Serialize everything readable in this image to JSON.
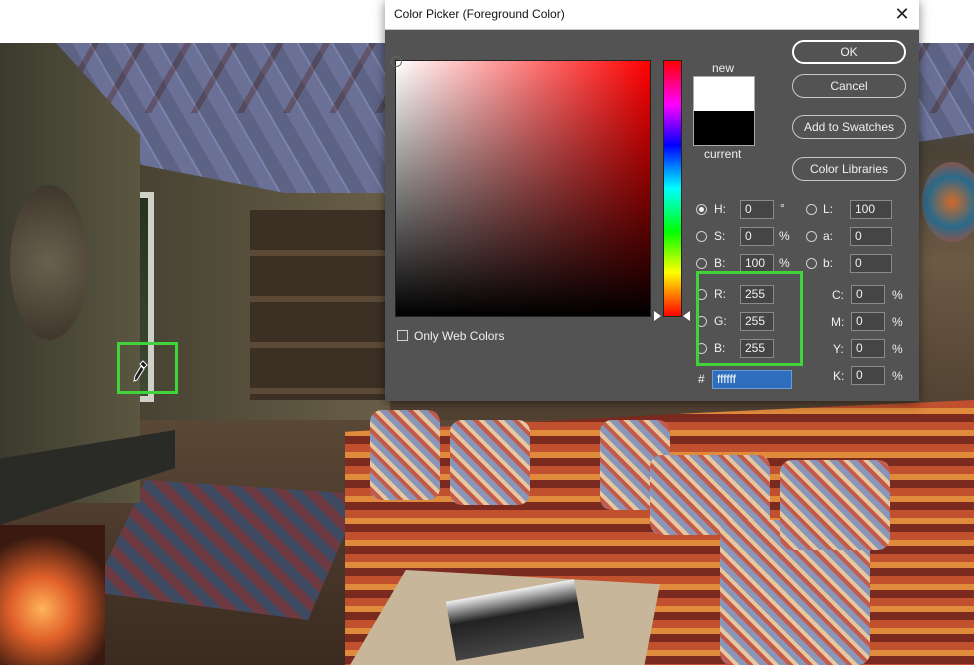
{
  "dialog": {
    "title": "Color Picker (Foreground Color)",
    "close_glyph": "✕",
    "swatch_new_label": "new",
    "swatch_current_label": "current",
    "new_color": "#ffffff",
    "current_color": "#000000",
    "buttons": {
      "ok": "OK",
      "cancel": "Cancel",
      "add_to_swatches": "Add to Swatches",
      "color_libraries": "Color Libraries"
    },
    "only_web_colors": "Only Web Colors",
    "hsb": {
      "h": {
        "label": "H:",
        "value": "0",
        "unit": "°",
        "selected": true
      },
      "s": {
        "label": "S:",
        "value": "0",
        "unit": "%"
      },
      "b": {
        "label": "B:",
        "value": "100",
        "unit": "%"
      }
    },
    "rgb": {
      "r": {
        "label": "R:",
        "value": "255"
      },
      "g": {
        "label": "G:",
        "value": "255"
      },
      "b": {
        "label": "B:",
        "value": "255"
      }
    },
    "lab": {
      "l": {
        "label": "L:",
        "value": "100"
      },
      "a": {
        "label": "a:",
        "value": "0"
      },
      "b": {
        "label": "b:",
        "value": "0"
      }
    },
    "cmyk": {
      "c": {
        "label": "C:",
        "value": "0",
        "unit": "%"
      },
      "m": {
        "label": "M:",
        "value": "0",
        "unit": "%"
      },
      "y": {
        "label": "Y:",
        "value": "0",
        "unit": "%"
      },
      "k": {
        "label": "K:",
        "value": "0",
        "unit": "%"
      }
    },
    "hex": {
      "label": "#",
      "value": "ffffff"
    }
  },
  "colors": {
    "highlight": "#3ed43a",
    "hex_selection": "#2f6dbd"
  },
  "icons": [
    "eyedropper-icon",
    "close-icon"
  ]
}
